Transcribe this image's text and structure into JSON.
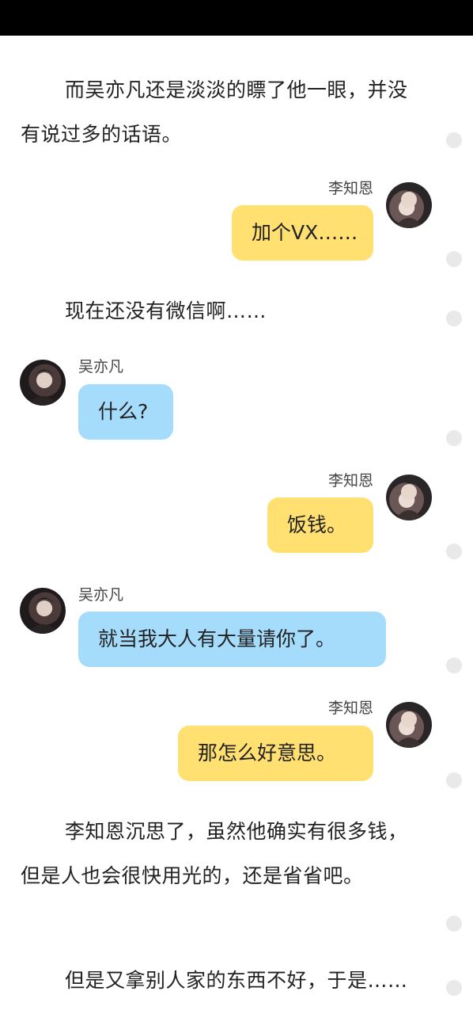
{
  "paragraphs": [
    "而吴亦凡还是淡淡的瞟了他一眼，并没有说过多的话语。",
    "现在还没有微信啊……",
    "李知恩沉思了，虽然他确实有很多钱，但是人也会很快用光的，还是省省吧。",
    "但是又拿别人家的东西不好，于是……"
  ],
  "messages": [
    {
      "sender": "李知恩",
      "text": "加个VX……"
    },
    {
      "sender": "吴亦凡",
      "text": "什么?"
    },
    {
      "sender": "李知恩",
      "text": "饭钱。"
    },
    {
      "sender": "吴亦凡",
      "text": "就当我大人有大量请你了。"
    },
    {
      "sender": "李知恩",
      "text": "那怎么好意思。"
    }
  ],
  "colors": {
    "right_bubble": "#ffe071",
    "left_bubble": "#a6dcfb",
    "top_bar": "#000000",
    "dot": "#e9e9e9"
  },
  "icons": {
    "avatar_lizhien": "avatar-lizhien",
    "avatar_wuyifan": "avatar-wuyifan",
    "comment_dot": "comment-dot-icon"
  }
}
